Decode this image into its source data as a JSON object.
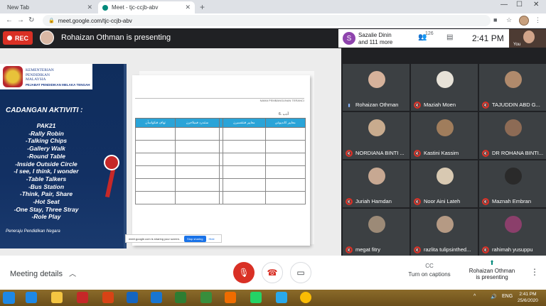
{
  "browser": {
    "tabs": [
      {
        "title": "New Tab",
        "active": false
      },
      {
        "title": "Meet - tjc-ccjb-abv",
        "active": true
      }
    ],
    "url": "meet.google.com/tjc-ccjb-abv"
  },
  "meet": {
    "rec_label": "REC",
    "presenting_text": "Rohaizan Othman is presenting",
    "join_avatar_letter": "S",
    "join_text_line1": "Sazalie Dinin",
    "join_text_line2": "and 111 more",
    "people_count": "126",
    "time": "2:41 PM",
    "you_label": "You"
  },
  "slide": {
    "logo_line1": "KEMENTERIAN",
    "logo_line2": "PENDIDIKAN",
    "logo_line3": "MALAYSIA",
    "logo_sub": "PEJABAT PENDIDIKAN MELAKA TENGAH",
    "heading": "CADANGAN AKTIVITI :",
    "activities": [
      "PAK21",
      "-Rally Robin",
      "-Talking Chips",
      "-Gallery Walk",
      "-Round Table",
      "-Inside Outside Circle",
      "-I see, I think, I wonder",
      "-Table Talkers",
      "-Bus Station",
      "-Think, Pair, Share",
      "-Hot Seat",
      "-One Stay, Three Stray",
      "-Role Play"
    ],
    "motto": "Peneraju Pendidikan Negara",
    "doc_header": "NAMA PEMBANGUNAN TERANCI",
    "doc_sub": "6. أدب",
    "table_headers": [
      "معايير كانديوغن",
      "معايير فنتقسيرن",
      "",
      "ستندرد فمبلاجرن",
      "تهاف فنکواسأن"
    ],
    "share_text": "meet.google.com is sharing your screen.",
    "stop_sharing": "Stop sharing",
    "hide": "Hide"
  },
  "participants": [
    {
      "name": "Rohaizan Othman",
      "muted": false,
      "face": "#d6b29b"
    },
    {
      "name": "Maziah Moen",
      "muted": true,
      "face": "#e7e2d8"
    },
    {
      "name": "TAJUDDIN ABD G...",
      "muted": true,
      "face": "#b08a6c"
    },
    {
      "name": "NORDIANA BINTI ...",
      "muted": true,
      "face": "#c8ab8e"
    },
    {
      "name": "Kastini Kassim",
      "muted": true,
      "face": "#a07d5c"
    },
    {
      "name": "DR ROHANA BINTI...",
      "muted": true,
      "face": "#8d6b55"
    },
    {
      "name": "Juriah Hamdan",
      "muted": true,
      "face": "#c7a892"
    },
    {
      "name": "Noor Aini Lateh",
      "muted": true,
      "face": "#d8c9b2"
    },
    {
      "name": "Maznah Embran",
      "muted": true,
      "face": "#2a2a2a"
    },
    {
      "name": "megat fitry",
      "muted": true,
      "face": "#9c8a77"
    },
    {
      "name": "razlita tulipsinthed...",
      "muted": true,
      "face": "#b59a84"
    },
    {
      "name": "rahimah yusuppu",
      "muted": true,
      "face": "#8b3f6b"
    }
  ],
  "controls": {
    "meeting_details": "Meeting details",
    "captions_label": "Turn on captions",
    "present_line1": "Rohaizan Othman",
    "present_line2": "is presenting"
  },
  "taskbar": {
    "lang": "ENG",
    "clock_time": "2:41 PM",
    "clock_date": "25/6/2020"
  },
  "colors": {
    "rec_red": "#d93025",
    "meet_dark": "#202124",
    "slide_navy": "#123063",
    "table_header_blue": "#2aa4d8"
  }
}
